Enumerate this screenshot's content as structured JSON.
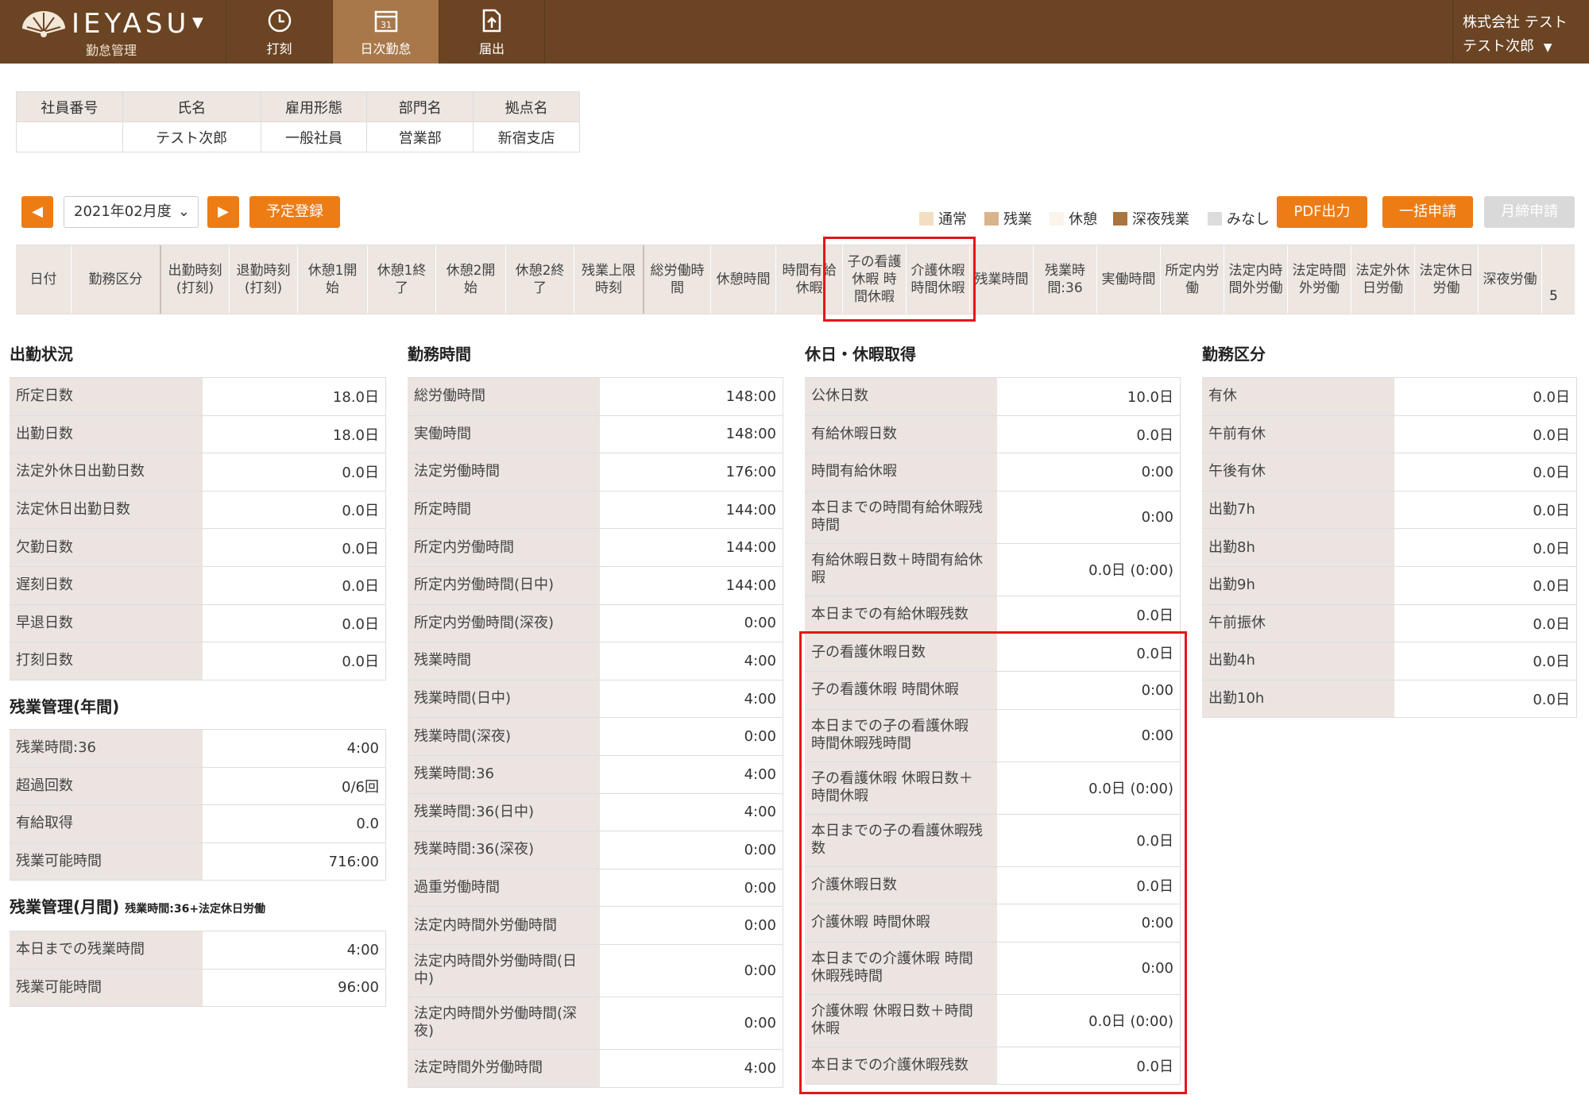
{
  "header": {
    "logo": "IEYASU",
    "sub": "勤怠管理",
    "nav": [
      {
        "label": "打刻"
      },
      {
        "label": "日次勤怠"
      },
      {
        "label": "届出"
      }
    ],
    "company": "株式会社 テスト",
    "user": "テスト次郎"
  },
  "info": {
    "headers": [
      "社員番号",
      "氏名",
      "雇用形態",
      "部門名",
      "拠点名"
    ],
    "values": [
      "",
      "テスト次郎",
      "一般社員",
      "営業部",
      "新宿支店"
    ]
  },
  "toolbar": {
    "month": "2021年02月度",
    "yotei": "予定登録",
    "pdf": "PDF出力",
    "ikkatsu": "一括申請",
    "getsu": "月締申請",
    "legend": [
      {
        "label": "通常",
        "color": "#f2dfc2"
      },
      {
        "label": "残業",
        "color": "#d8b48c"
      },
      {
        "label": "休憩",
        "color": "#fbf4ea"
      },
      {
        "label": "深夜残業",
        "color": "#a8743f"
      },
      {
        "label": "みなし",
        "color": "#dcdcdc"
      }
    ]
  },
  "columns": [
    "日付",
    "勤務区分",
    "出勤時刻\n(打刻)",
    "退勤時刻\n(打刻)",
    "休憩1開\n始",
    "休憩1終\n了",
    "休憩2開\n始",
    "休憩2終\n了",
    "残業上限\n時刻",
    "総労働時\n間",
    "休憩時間",
    "時間有給\n休暇",
    "子の看護\n休暇 時\n間休暇",
    "介護休暇\n時間休暇",
    "残業時間",
    "残業時\n間:36",
    "実働時間",
    "所定内労\n働",
    "法定内時\n間外労働",
    "法定時間\n外労働",
    "法定外休\n日労働",
    "法定休日\n労働",
    "深夜労働"
  ],
  "colFive": "5",
  "sections": {
    "attendance": {
      "title": "出勤状況",
      "rows": [
        [
          "所定日数",
          "18.0日"
        ],
        [
          "出勤日数",
          "18.0日"
        ],
        [
          "法定外休日出勤日数",
          "0.0日"
        ],
        [
          "法定休日出勤日数",
          "0.0日"
        ],
        [
          "欠勤日数",
          "0.0日"
        ],
        [
          "遅刻日数",
          "0.0日"
        ],
        [
          "早退日数",
          "0.0日"
        ],
        [
          "打刻日数",
          "0.0日"
        ]
      ]
    },
    "overtimeYear": {
      "title": "残業管理(年間)",
      "rows": [
        [
          "残業時間:36",
          "4:00"
        ],
        [
          "超過回数",
          "0/6回"
        ],
        [
          "有給取得",
          "0.0"
        ],
        [
          "残業可能時間",
          "716:00"
        ]
      ]
    },
    "overtimeMonth": {
      "title": "残業管理(月間)",
      "note": "残業時間:36+法定休日労働",
      "rows": [
        [
          "本日までの残業時間",
          "4:00"
        ],
        [
          "残業可能時間",
          "96:00"
        ]
      ]
    },
    "worktime": {
      "title": "勤務時間",
      "rows": [
        [
          "総労働時間",
          "148:00"
        ],
        [
          "実働時間",
          "148:00"
        ],
        [
          "法定労働時間",
          "176:00"
        ],
        [
          "所定時間",
          "144:00"
        ],
        [
          "所定内労働時間",
          "144:00"
        ],
        [
          "所定内労働時間(日中)",
          "144:00"
        ],
        [
          "所定内労働時間(深夜)",
          "0:00"
        ],
        [
          "残業時間",
          "4:00"
        ],
        [
          "残業時間(日中)",
          "4:00"
        ],
        [
          "残業時間(深夜)",
          "0:00"
        ],
        [
          "残業時間:36",
          "4:00"
        ],
        [
          "残業時間:36(日中)",
          "4:00"
        ],
        [
          "残業時間:36(深夜)",
          "0:00"
        ],
        [
          "過重労働時間",
          "0:00"
        ],
        [
          "法定内時間外労働時間",
          "0:00"
        ],
        [
          "法定内時間外労働時間(日\n中)",
          "0:00"
        ],
        [
          "法定内時間外労働時間(深\n夜)",
          "0:00"
        ],
        [
          "法定時間外労働時間",
          "4:00"
        ]
      ]
    },
    "holiday": {
      "title": "休日・休暇取得",
      "rows": [
        [
          "公休日数",
          "10.0日"
        ],
        [
          "有給休暇日数",
          "0.0日"
        ],
        [
          "時間有給休暇",
          "0:00"
        ],
        [
          "本日までの時間有給休暇残\n時間",
          "0:00"
        ],
        [
          "有給休暇日数＋時間有給休\n暇",
          "0.0日 (0:00)"
        ],
        [
          "本日までの有給休暇残数",
          "0.0日"
        ],
        [
          "子の看護休暇日数",
          "0.0日"
        ],
        [
          "子の看護休暇 時間休暇",
          "0:00"
        ],
        [
          "本日までの子の看護休暇\n時間休暇残時間",
          "0:00"
        ],
        [
          "子の看護休暇 休暇日数＋\n時間休暇",
          "0.0日 (0:00)"
        ],
        [
          "本日までの子の看護休暇残\n数",
          "0.0日"
        ],
        [
          "介護休暇日数",
          "0.0日"
        ],
        [
          "介護休暇 時間休暇",
          "0:00"
        ],
        [
          "本日までの介護休暇 時間\n休暇残時間",
          "0:00"
        ],
        [
          "介護休暇 休暇日数＋時間\n休暇",
          "0.0日 (0:00)"
        ],
        [
          "本日までの介護休暇残数",
          "0.0日"
        ]
      ]
    },
    "category": {
      "title": "勤務区分",
      "rows": [
        [
          "有休",
          "0.0日"
        ],
        [
          "午前有休",
          "0.0日"
        ],
        [
          "午後有休",
          "0.0日"
        ],
        [
          "出勤7h",
          "0.0日"
        ],
        [
          "出勤8h",
          "0.0日"
        ],
        [
          "出勤9h",
          "0.0日"
        ],
        [
          "午前振休",
          "0.0日"
        ],
        [
          "出勤4h",
          "0.0日"
        ],
        [
          "出勤10h",
          "0.0日"
        ]
      ]
    }
  }
}
